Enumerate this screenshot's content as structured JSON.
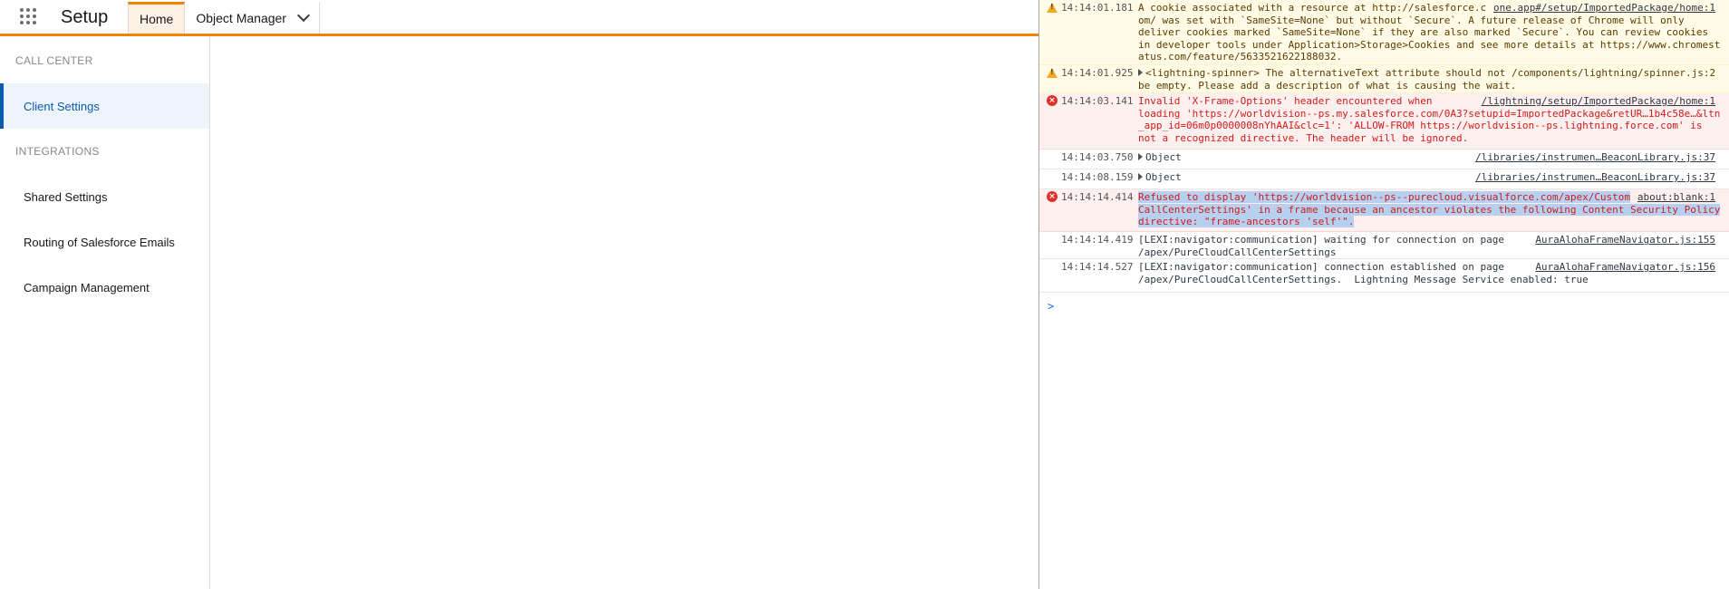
{
  "header": {
    "app_name": "Setup",
    "tabs": [
      {
        "label": "Home",
        "active": true
      },
      {
        "label": "Object Manager",
        "active": false
      }
    ]
  },
  "sidebar": {
    "sections": [
      {
        "title": "CALL CENTER",
        "items": [
          {
            "label": "Client Settings",
            "selected": true
          }
        ]
      },
      {
        "title": "INTEGRATIONS",
        "items": [
          {
            "label": "Shared Settings"
          },
          {
            "label": "Routing of Salesforce Emails"
          },
          {
            "label": "Campaign Management"
          }
        ]
      }
    ]
  },
  "console": {
    "colors": {
      "accent": "#f38303",
      "selected": "#0b5cab",
      "error": "#d11b1b",
      "warning_bg": "#fffbe6",
      "error_bg": "#fff0f0"
    },
    "messages": [
      {
        "level": "warning",
        "time": "14:14:01.181",
        "source": "one.app#/setup/ImportedPackage/home:1",
        "lines": [
          "A cookie associated with a resource at http://salesforce.c",
          "om/ was set with `SameSite=None` but without `Secure`. A future release of Chrome will only",
          "deliver cookies marked `SameSite=None` if they are also marked `Secure`. You can review cookies",
          "in developer tools under Application>Storage>Cookies and see more details at https://www.chromest",
          "atus.com/feature/5633521622188032."
        ]
      },
      {
        "level": "warning",
        "time": "14:14:01.925",
        "source": "",
        "lines": [
          "<lightning-spinner> The alternativeText attribute should not /components/lightning/spinner.js:2",
          "be empty. Please add a description of what is causing the wait."
        ]
      },
      {
        "level": "error",
        "time": "14:14:03.141",
        "source": "/lightning/setup/ImportedPackage/home:1",
        "lines": [
          "Invalid 'X-Frame-Options' header encountered when",
          "loading 'https://worldvision--ps.my.salesforce.com/0A3?setupid=ImportedPackage&retUR…1b4c58e…&ltn",
          "_app_id=06m0p0000008nYhAAI&clc=1': 'ALLOW-FROM https://worldvision--ps.lightning.force.com' is",
          "not a recognized directive. The header will be ignored."
        ]
      },
      {
        "level": "info",
        "time": "14:14:03.750",
        "source": "/libraries/instrumen…BeaconLibrary.js:37",
        "lines": [
          "Object"
        ]
      },
      {
        "level": "info",
        "time": "14:14:08.159",
        "source": "/libraries/instrumen…BeaconLibrary.js:37",
        "lines": [
          "Object"
        ]
      },
      {
        "level": "error",
        "time": "14:14:14.414",
        "source": "about:blank:1",
        "lines": [
          "Refused to display 'https://worldvision--ps--purecloud.visualforce.com/apex/Custom",
          "CallCenterSettings' in a frame because an ancestor violates the following Content Security Policy",
          "directive: \"frame-ancestors 'self'\"."
        ]
      },
      {
        "level": "info",
        "time": "14:14:14.419",
        "source": "AuraAlohaFrameNavigator.js:155",
        "lines": [
          "[LEXI:navigator:communication] waiting for connection on page",
          "/apex/PureCloudCallCenterSettings"
        ]
      },
      {
        "level": "info",
        "time": "14:14:14.527",
        "source": "AuraAlohaFrameNavigator.js:156",
        "lines": [
          "[LEXI:navigator:communication] connection established on page",
          "/apex/PureCloudCallCenterSettings.  Lightning Message Service enabled: true"
        ]
      }
    ],
    "prompt": ">"
  }
}
